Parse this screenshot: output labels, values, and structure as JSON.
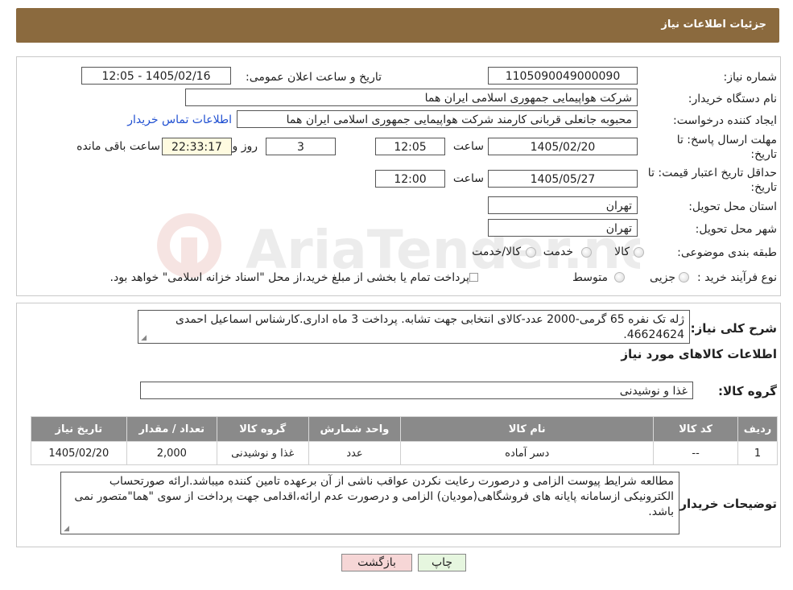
{
  "header": {
    "title": "جزئیات اطلاعات نیاز"
  },
  "form": {
    "need_number_label": "شماره نیاز:",
    "need_number": "1105090049000090",
    "announce_label": "تاریخ و ساعت اعلان عمومی:",
    "announce_value": "1405/02/16 - 12:05",
    "buyer_org_label": "نام دستگاه خریدار:",
    "buyer_org": "شرکت هواپیمایی جمهوری اسلامی ایران هما",
    "creator_label": "ایجاد کننده درخواست:",
    "creator": "محبوبه جانعلی قربانی کارمند شرکت هواپیمایی جمهوری اسلامی ایران هما",
    "contact_link": "اطلاعات تماس خریدار",
    "deadline_label": "مهلت ارسال پاسخ: تا",
    "deadline_label2": "تاریخ:",
    "deadline_date": "1405/02/20",
    "time_label": "ساعت",
    "deadline_time": "12:05",
    "days_value": "3",
    "days_label": "روز و",
    "remaining_time": "22:33:17",
    "remaining_label": "ساعت باقی مانده",
    "validity_label": "حداقل تاریخ اعتبار قیمت: تا",
    "validity_label2": "تاریخ:",
    "validity_date": "1405/05/27",
    "validity_time_label": "ساعت",
    "validity_time": "12:00",
    "province_label": "استان محل تحویل:",
    "province": "تهران",
    "city_label": "شهر محل تحویل:",
    "city": "تهران",
    "category_label": "طبقه بندی موضوعی:",
    "category_options": [
      "کالا",
      "خدمت",
      "کالا/خدمت"
    ],
    "process_label": "نوع فرآیند خرید :",
    "process_options": [
      "جزیی",
      "متوسط"
    ],
    "process_note": "پرداخت تمام یا بخشی از مبلغ خرید،از محل \"اسناد خزانه اسلامی\" خواهد بود."
  },
  "description": {
    "label": "شرح کلی نیاز:",
    "text": "ژله تک نفره 65 گرمی-2000 عدد-کالای انتخابی جهت تشابه. پرداخت 3 ماه اداری.کارشناس اسماعیل احمدی 46624624."
  },
  "goods": {
    "section_title": "اطلاعات کالاهای مورد نیاز",
    "group_label": "گروه کالا:",
    "group_value": "غذا و نوشیدنی",
    "columns": [
      "ردیف",
      "کد کالا",
      "نام کالا",
      "واحد شمارش",
      "گروه کالا",
      "تعداد / مقدار",
      "تاریخ نیاز"
    ],
    "rows": [
      [
        "1",
        "--",
        "دسر آماده",
        "عدد",
        "غذا و نوشیدنی",
        "2,000",
        "1405/02/20"
      ]
    ]
  },
  "buyer_notes": {
    "label": "توضیحات خریدار:",
    "text": "مطالعه شرایط پیوست الزامی و درصورت رعایت نکردن عواقب ناشی از آن برعهده تامین کننده میباشد.ارائه صورتحساب الکترونیکی ازسامانه پایانه های فروشگاهی(مودیان) الزامی و درصورت عدم ارائه،اقدامی جهت پرداخت از سوی \"هما\"متصور نمی باشد."
  },
  "buttons": {
    "print": "چاپ",
    "back": "بازگشت"
  },
  "watermark": {
    "text": "AriaTender.neT"
  },
  "colors": {
    "header_bg": "#8b6a3e",
    "link": "#1f4fd1",
    "table_head": "#8a8a8a",
    "back_button": "#f6d6d6",
    "print_button": "#e6f6df"
  }
}
